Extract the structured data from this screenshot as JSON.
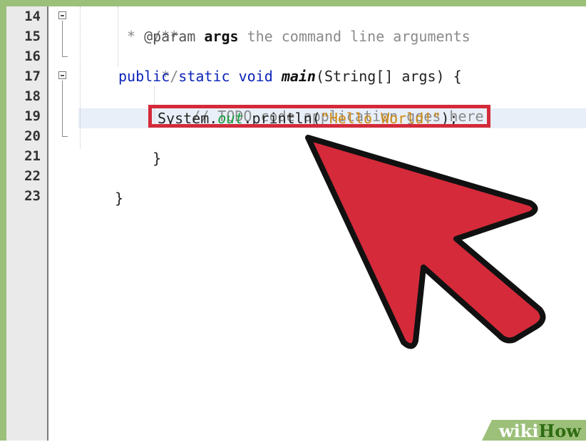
{
  "editor": {
    "line_numbers": [
      "14",
      "15",
      "16",
      "17",
      "18",
      "19",
      "20",
      "21",
      "22",
      "23"
    ],
    "lines": {
      "l14_comment_open": "/**",
      "l15_star": "* ",
      "l15_tag": "@param",
      "l15_space": " ",
      "l15_param": "args",
      "l15_desc": " the command line arguments",
      "l16_comment_close": "*/",
      "l17_public": "public",
      "l17_static": "static",
      "l17_void": "void",
      "l17_method": "main",
      "l17_sig": "(String[] args) {",
      "l18_todo": "// TODO code application goes here",
      "l19_system": "System.",
      "l19_out": "out",
      "l19_println": ".println(",
      "l19_string": "\"Hello World!\"",
      "l19_end": ");",
      "l20_brace": "}",
      "l22_brace": "}"
    },
    "current_line": "19"
  },
  "callout": {
    "highlight_color": "#d42a3a",
    "arrow_color": "#d42a3a",
    "outline_color": "#111111"
  },
  "watermark": {
    "part1": "wiki",
    "part2": "How"
  },
  "colors": {
    "frame": "#9cc07a",
    "keyword": "#0b24b8",
    "comment": "#8a8a8a",
    "field": "#149e3a",
    "string": "#d08a12"
  }
}
